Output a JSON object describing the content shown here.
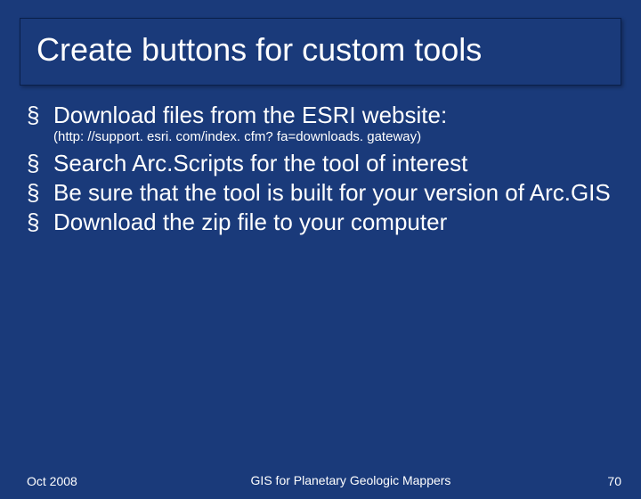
{
  "title": "Create buttons for custom tools",
  "bullets": [
    {
      "text": "Download files from the ESRI website:",
      "subnote": "(http: //support. esri. com/index. cfm? fa=downloads. gateway)"
    },
    {
      "text": "Search Arc.Scripts for the tool of interest"
    },
    {
      "text": "Be sure that the tool is built for your version of Arc.GIS"
    },
    {
      "text": "Download the zip file to your computer"
    }
  ],
  "footer": {
    "left": "Oct 2008",
    "center": "GIS for Planetary Geologic Mappers",
    "right": "70"
  }
}
